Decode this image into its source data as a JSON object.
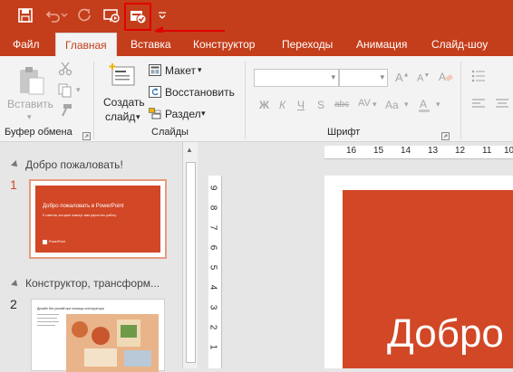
{
  "tabs": [
    "Файл",
    "Главная",
    "Вставка",
    "Конструктор",
    "Переходы",
    "Анимация",
    "Слайд-шоу"
  ],
  "ribbon": {
    "paste_label": "Вставить",
    "create_slide_line1": "Создать",
    "create_slide_line2": "слайд",
    "layout_label": "Макет",
    "reset_label": "Восстановить",
    "section_label": "Раздел",
    "groups": {
      "clipboard": "Буфер обмена",
      "slides": "Слайды",
      "font": "Шрифт"
    },
    "font_buttons": [
      "Ж",
      "К",
      "Ч",
      "S",
      "abc",
      "AV",
      "Aa"
    ]
  },
  "pane": {
    "section1": "Добро пожаловать!",
    "section2": "Конструктор, трансформ...",
    "slide1_num": "1",
    "slide2_num": "2",
    "thumb1_title": "Добро пожаловать в PowerPoint",
    "thumb1_subtitle": "5 советов, которые помогут вам упростить работу",
    "thumb1_logo": "PowerPoint",
    "thumb2_title": "Дизайн без усилий при помощи конструктора"
  },
  "ruler": {
    "h_ticks": [
      "16",
      "15",
      "14",
      "13",
      "12",
      "11",
      "10"
    ],
    "v_ticks": [
      "9",
      "8",
      "7",
      "6",
      "5",
      "4",
      "3",
      "2",
      "1"
    ]
  },
  "slide": {
    "big_title": "Добро"
  },
  "colors": {
    "accent": "#c43e1c",
    "slide_bg": "#d24726",
    "highlight": "#e00000"
  }
}
